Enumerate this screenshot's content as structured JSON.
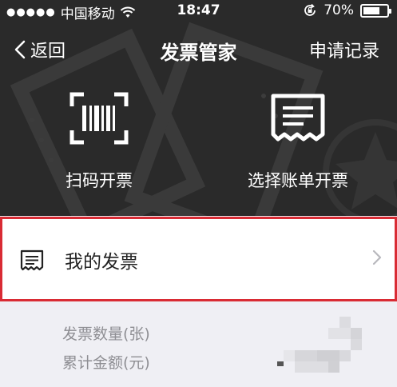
{
  "status_bar": {
    "carrier": "中国移动",
    "time": "18:47",
    "battery_percent": "70%",
    "battery_level": 0.7,
    "icons": [
      "signal-dots-icon",
      "wifi-icon",
      "rotation-lock-icon",
      "battery-icon"
    ]
  },
  "nav": {
    "back_label": "返回",
    "title": "发票管家",
    "right_label": "申请记录"
  },
  "actions": [
    {
      "label": "扫码开票",
      "icon": "barcode-scan-icon"
    },
    {
      "label": "选择账单开票",
      "icon": "receipt-icon"
    }
  ],
  "my_invoices": {
    "label": "我的发票",
    "icon": "invoice-icon",
    "chevron": "chevron-right-icon"
  },
  "stats": [
    {
      "label": "发票数量(张)"
    },
    {
      "label": "累计金额(元)"
    }
  ],
  "colors": {
    "header_bg": "#2a2a2a",
    "highlight_border": "#d92b34",
    "page_bg": "#efeff4"
  }
}
